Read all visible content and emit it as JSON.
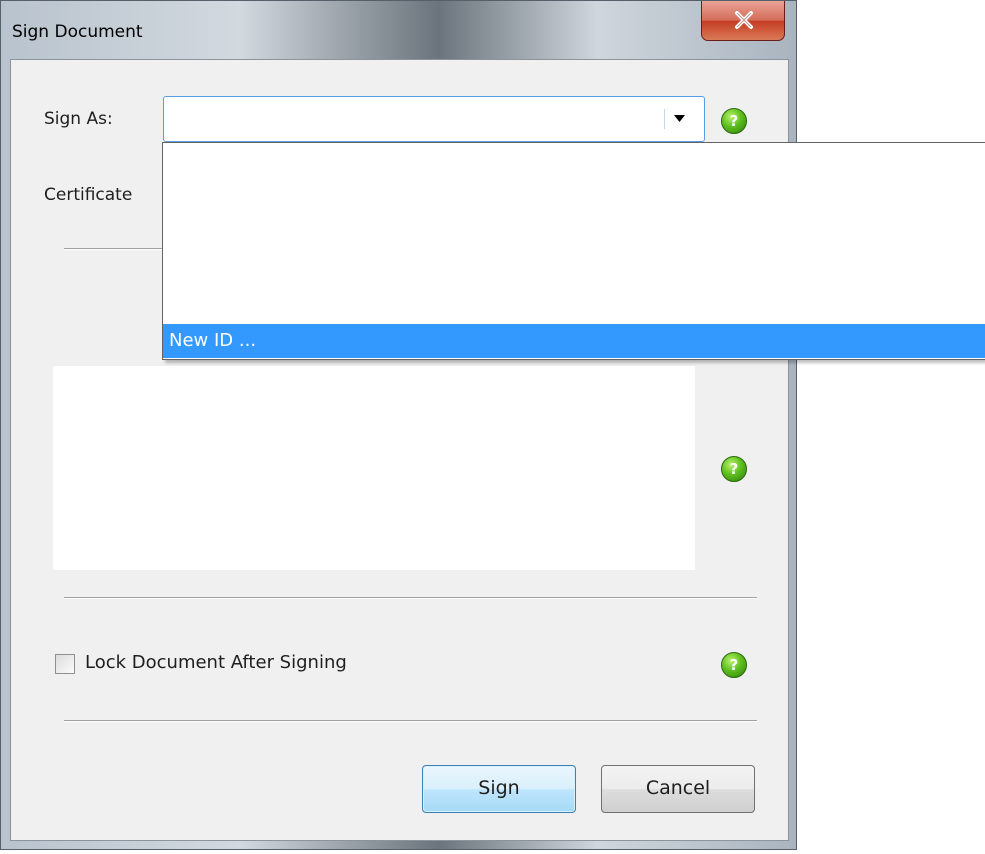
{
  "window": {
    "title": "Sign Document",
    "close_tooltip_icon": "close-icon"
  },
  "form": {
    "sign_as_label": "Sign As:",
    "sign_as_value": "",
    "certificate_label": "Certificate",
    "lock_label": "Lock Document After Signing",
    "lock_checked": false,
    "help_glyph": "?"
  },
  "dropdown": {
    "items": [
      {
        "label": "New ID ...",
        "highlighted": true
      }
    ]
  },
  "buttons": {
    "sign": "Sign",
    "cancel": "Cancel"
  },
  "colors": {
    "selection": "#3399ff",
    "help_green": "#5fbf1e",
    "close_red": "#c43c23"
  }
}
